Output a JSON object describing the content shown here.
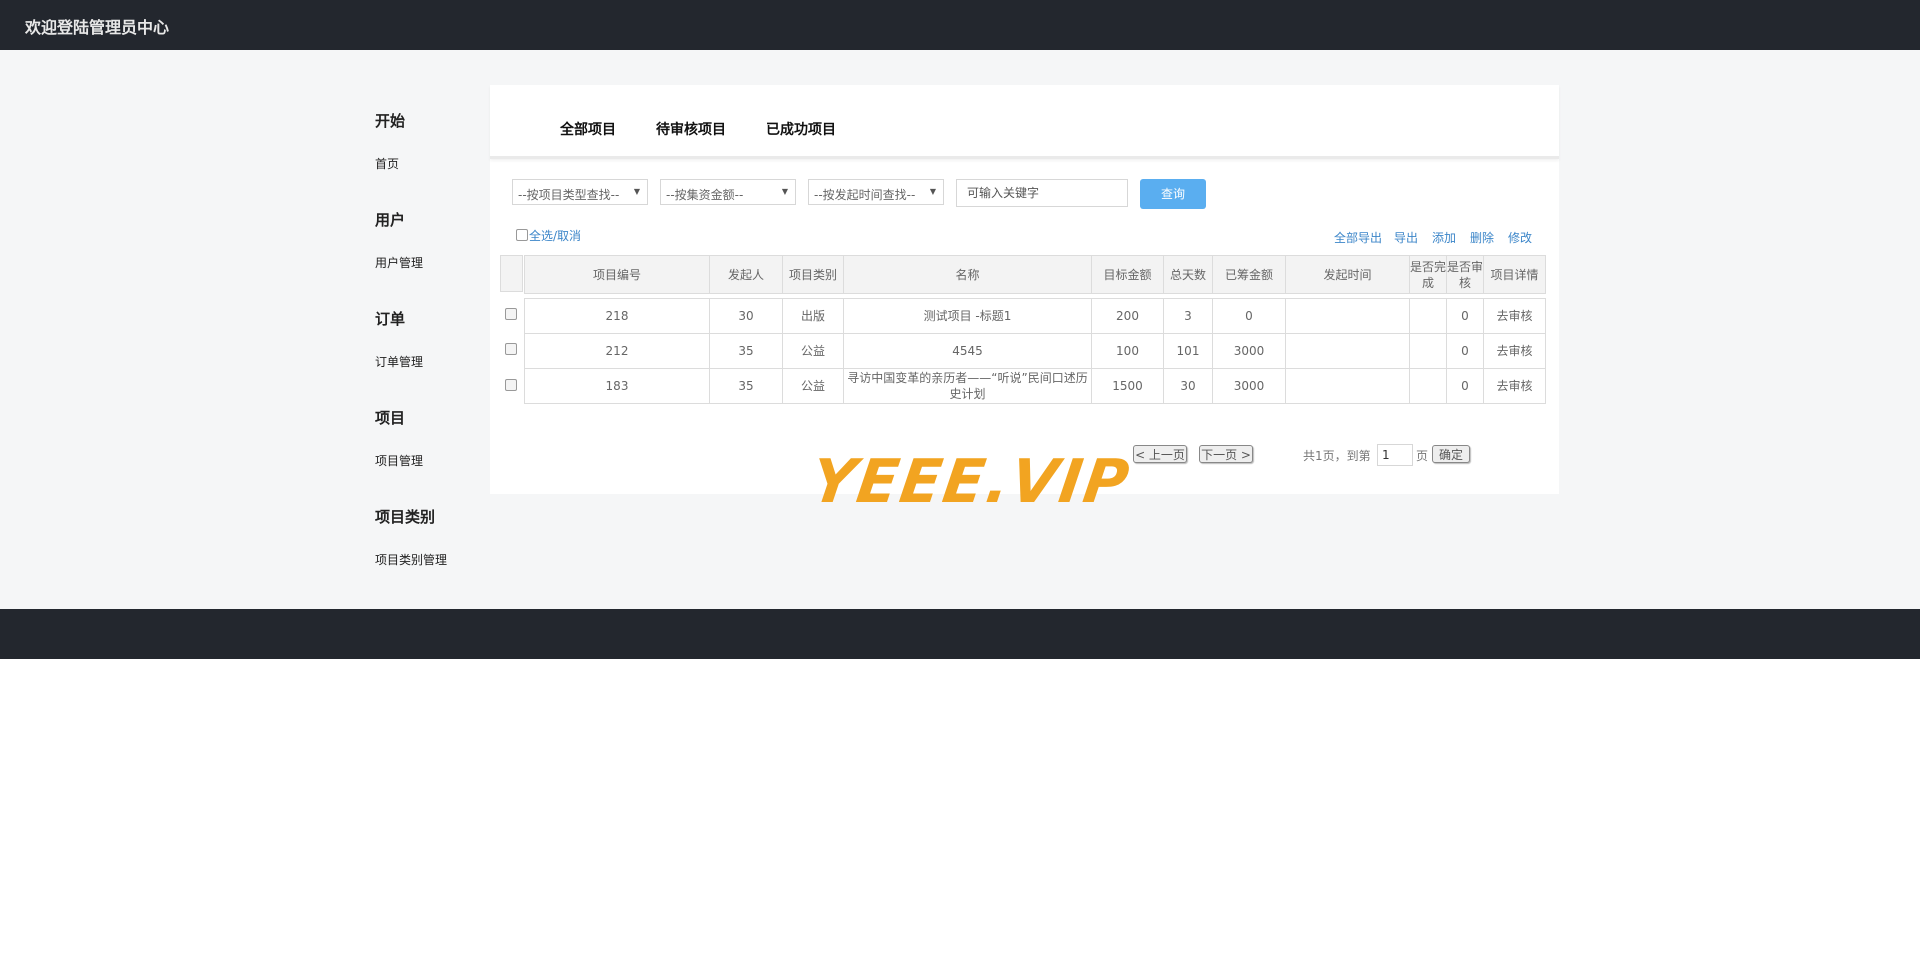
{
  "header": {
    "title": "欢迎登陆管理员中心"
  },
  "sidebar": {
    "sections": [
      {
        "heading": "开始",
        "link": "首页"
      },
      {
        "heading": "用户",
        "link": "用户管理"
      },
      {
        "heading": "订单",
        "link": "订单管理"
      },
      {
        "heading": "项目",
        "link": "项目管理"
      },
      {
        "heading": "项目类别",
        "link": "项目类别管理"
      }
    ]
  },
  "tabs": [
    "全部项目",
    "待审核项目",
    "已成功项目"
  ],
  "filters": {
    "type": "--按项目类型查找--",
    "amount": "--按集资金额--",
    "time": "--按发起时间查找--",
    "keyword_placeholder": "可输入关键字",
    "query_label": "查询"
  },
  "select_all_label": "全选/取消",
  "actions": [
    "全部导出",
    "导出",
    "添加",
    "删除",
    "修改"
  ],
  "table": {
    "headers": [
      "项目编号",
      "发起人",
      "项目类别",
      "名称",
      "目标金额",
      "总天数",
      "已筹金额",
      "发起时间",
      "是否完成",
      "是否审核",
      "项目详情"
    ],
    "rows": [
      [
        "218",
        "30",
        "出版",
        "测试项目 -标题1",
        "200",
        "3",
        "0",
        "",
        "",
        "0",
        "去审核"
      ],
      [
        "212",
        "35",
        "公益",
        "4545",
        "100",
        "101",
        "3000",
        "",
        "",
        "0",
        "去审核"
      ],
      [
        "183",
        "35",
        "公益",
        "寻访中国变革的亲历者——“听说”民间口述历史计划",
        "1500",
        "30",
        "3000",
        "",
        "",
        "0",
        "去审核"
      ]
    ]
  },
  "pager": {
    "prev": "< 上一页",
    "next": "下一页 >",
    "total": "共1页，到第",
    "page_value": "1",
    "page_unit": "页",
    "confirm": "确定"
  },
  "watermark": "YEEE.VIP",
  "colors": {
    "topbar": "#23272e",
    "accent": "#5aaef0",
    "link": "#3c86c9",
    "watermark": "#f2a421"
  }
}
